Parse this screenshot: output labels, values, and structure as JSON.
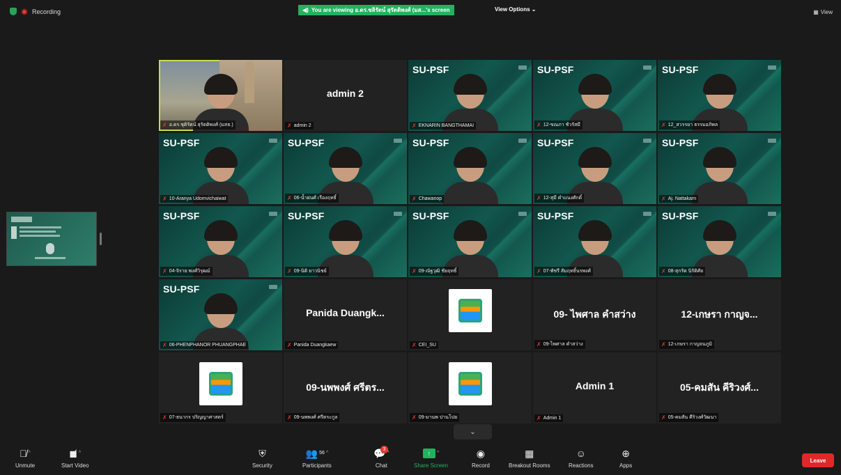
{
  "topbar": {
    "recording_label": "Recording",
    "viewing_label": "You are viewing อ.ดร.ชลิรัตน์ สุรัตติพงศ์ (มส...'s screen",
    "view_options_label": "View Options ⌄",
    "view_label": "View"
  },
  "tiles": [
    {
      "header": "",
      "big_name": "",
      "label": "อ.ดร.ชุติรัตน์ สุรัตติพงศ์ (มสธ.)",
      "kind": "camera-active"
    },
    {
      "header": "",
      "big_name": "admin 2",
      "label": "admin 2",
      "kind": "name"
    },
    {
      "header": "SU-PSF",
      "big_name": "",
      "label": "EKNARIN BANGTHAMAI",
      "kind": "video"
    },
    {
      "header": "SU-PSF",
      "big_name": "",
      "label": "12-ขณภา ชัวรัสมี",
      "kind": "video"
    },
    {
      "header": "SU-PSF",
      "big_name": "",
      "label": "12_สวรรยา ธรรมอภิพล",
      "kind": "video"
    },
    {
      "header": "SU-PSF",
      "big_name": "",
      "label": "10-Aranya Udomvichaiwat",
      "kind": "video"
    },
    {
      "header": "SU-PSF",
      "big_name": "",
      "label": "06-น้ำฝนศ์ เรืองฤทธิ์",
      "kind": "video"
    },
    {
      "header": "SU-PSF",
      "big_name": "",
      "label": "Chawanop",
      "kind": "video"
    },
    {
      "header": "SU-PSF",
      "big_name": "",
      "label": "12-สุมี คำแนงศักดิ์",
      "kind": "video"
    },
    {
      "header": "SU-PSF",
      "big_name": "",
      "label": "Aj. Nattakarn",
      "kind": "video"
    },
    {
      "header": "SU-PSF",
      "big_name": "",
      "label": "04-จิราย พงศ์วิรุฒม์",
      "kind": "video"
    },
    {
      "header": "SU-PSF",
      "big_name": "",
      "label": "09-นิติ ยาวนิชย์",
      "kind": "video"
    },
    {
      "header": "SU-PSF",
      "big_name": "",
      "label": "09-ณัฐวุฒิ ชัยฤทธิ์",
      "kind": "video"
    },
    {
      "header": "SU-PSF",
      "big_name": "",
      "label": "07-พัชรี สัมฤทธิ์นรพงศ์",
      "kind": "video"
    },
    {
      "header": "SU-PSF",
      "big_name": "",
      "label": "08-สุกรัต นิรัติศัย",
      "kind": "video"
    },
    {
      "header": "SU-PSF",
      "big_name": "",
      "label": "06-PHENPHANOR PHUANGPHAE",
      "kind": "video"
    },
    {
      "header": "",
      "big_name": "Panida Duangk...",
      "label": "Panida Duangkaew",
      "kind": "name"
    },
    {
      "header": "",
      "big_name": "",
      "label": "CEI_SU",
      "kind": "logo"
    },
    {
      "header": "",
      "big_name": "09- ไพศาล คำสว่าง",
      "label": "09-ไพศาล คำสว่าง",
      "kind": "name"
    },
    {
      "header": "",
      "big_name": "12-เกษรา กาญจ...",
      "label": "12-เกษรา กาญจนภูมิ",
      "kind": "name"
    },
    {
      "header": "",
      "big_name": "",
      "label": "07-ธนากร ปริญญาศาสตร์",
      "kind": "logo"
    },
    {
      "header": "",
      "big_name": "09-นพพงศ์ ศรีตร...",
      "label": "09-นพพงศ์ ศรีตระกูล",
      "kind": "name"
    },
    {
      "header": "",
      "big_name": "",
      "label": "09-มานพ ปานโปย",
      "kind": "logo"
    },
    {
      "header": "",
      "big_name": "Admin 1",
      "label": "Admin 1",
      "kind": "name"
    },
    {
      "header": "",
      "big_name": "05-คมสัน คีริวงศ์...",
      "label": "05-คมสัน คีริวงศ์วัฒนา",
      "kind": "name"
    }
  ],
  "toolbar": {
    "unmute": "Unmute",
    "start_video": "Start Video",
    "security": "Security",
    "participants": "Participants",
    "participants_count": "56",
    "chat": "Chat",
    "chat_badge": "3",
    "share_screen": "Share Screen",
    "record": "Record",
    "breakout_rooms": "Breakout Rooms",
    "reactions": "Reactions",
    "apps": "Apps",
    "leave": "Leave"
  },
  "colors": {
    "active_speaker_outline": "#c7dd4b",
    "share_green": "#23b25f",
    "leave_red": "#e02828",
    "muted_red": "#e03c31"
  }
}
